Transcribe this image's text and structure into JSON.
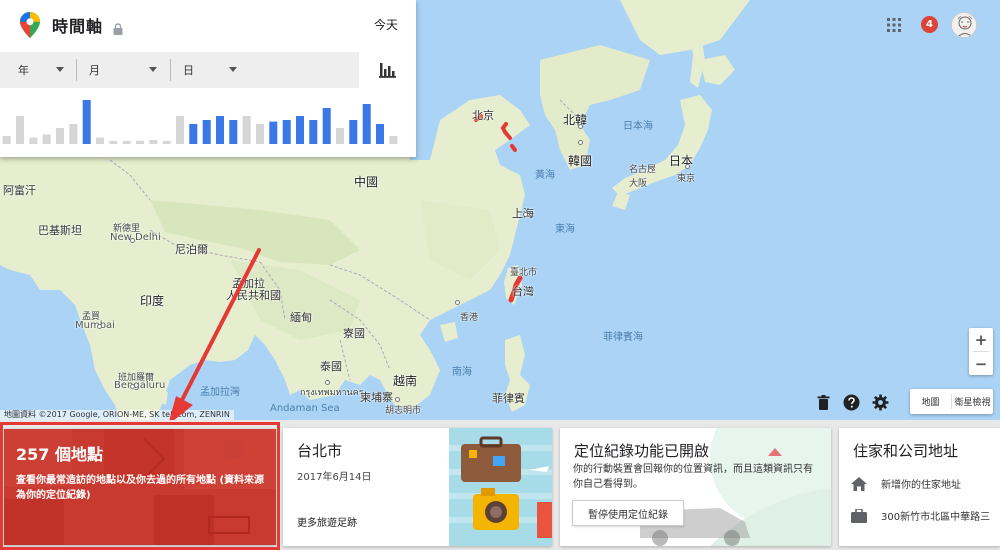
{
  "header": {
    "title": "時間軸",
    "today": "今天",
    "selects": {
      "year": "年",
      "month": "月",
      "day": "日"
    }
  },
  "activity_histogram": {
    "values": [
      10,
      35,
      8,
      12,
      20,
      25,
      55,
      8,
      4,
      4,
      4,
      5,
      4,
      35,
      25,
      30,
      35,
      30,
      35,
      25,
      28,
      30,
      35,
      30,
      45,
      20,
      30,
      50,
      25,
      10
    ],
    "highlighted": [
      false,
      false,
      false,
      false,
      false,
      false,
      true,
      false,
      false,
      false,
      false,
      false,
      false,
      false,
      true,
      true,
      true,
      true,
      false,
      false,
      true,
      true,
      true,
      true,
      true,
      false,
      true,
      true,
      true,
      false
    ],
    "accent": "#3b78e7",
    "muted": "#d6d6d6"
  },
  "top_bar": {
    "notification_count": "4"
  },
  "map": {
    "labels": {
      "beijing": "北京",
      "north_korea": "北韓",
      "south_korea": "韓國",
      "sea_of_japan": "日本海",
      "japan": "日本",
      "nagoya": "名古屋",
      "osaka": "大阪",
      "tokyo": "東京",
      "china": "中國",
      "yellow_sea": "黃海",
      "shanghai": "上海",
      "east_sea": "東海",
      "taipei": "臺北市",
      "taiwan": "台灣",
      "hong_kong": "香港",
      "philippine_sea": "菲律賓海",
      "south_sea": "南海",
      "philippines": "菲律賓",
      "afghanistan": "阿富汗",
      "pakistan": "巴基斯坦",
      "new_delhi": "新德里",
      "new_delhi_en": "New Delhi",
      "nepal": "尼泊爾",
      "bangladesh_1": "孟加拉",
      "bangladesh_2": "人民共和國",
      "india": "印度",
      "myanmar": "緬甸",
      "laos": "寮國",
      "mumbai_zh": "孟買",
      "mumbai_en": "Mumbai",
      "bengaluru_zh": "班加羅爾",
      "bengaluru_en": "Bengaluru",
      "bay_of_bengal": "孟加拉灣",
      "bangkok": "กรุงเทพมหานคร",
      "thailand": "泰國",
      "vietnam": "越南",
      "cambodia": "柬埔寨",
      "andaman_sea": "Andaman Sea",
      "ho_chi_minh": "胡志明市"
    },
    "attribution": "地圖資料 ©2017 Google, ORION-ME, SK telecom, ZENRIN",
    "zoom_in": "+",
    "zoom_out": "−",
    "map_type": {
      "map": "地圖",
      "satellite": "衛星檢視"
    },
    "route_color": "#e53935"
  },
  "cards": {
    "places": {
      "title": "257 個地點",
      "description": "查看你最常造訪的地點以及你去過的所有地點 (資料來源為你的定位紀錄)"
    },
    "trip": {
      "title": "台北市",
      "date": "2017年6月14日",
      "link": "更多旅遊足跡"
    },
    "location_history": {
      "title": "定位紀錄功能已開啟",
      "description": "你的行動裝置會回報你的位置資訊，而且這類資訊只有你自己看得到。",
      "button": "暫停使用定位紀錄"
    },
    "home_work": {
      "title": "住家和公司地址",
      "home": "新增你的住家地址",
      "work": "300新竹市北區中華路三"
    }
  }
}
